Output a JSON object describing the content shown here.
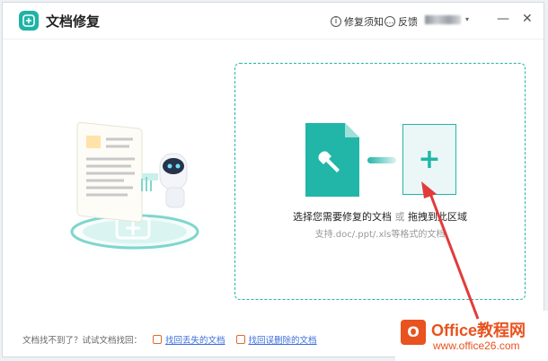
{
  "header": {
    "app_title": "文档修复",
    "help_label": "修复须知",
    "feedback_label": "反馈",
    "minimize_glyph": "—",
    "close_glyph": "✕"
  },
  "dropzone": {
    "instruction_main": "选择您需要修复的文档",
    "instruction_or": "或",
    "instruction_drag": "拖拽到此区域",
    "supported_formats": "支持.doc/.ppt/.xls等格式的文档",
    "plus_glyph": "+"
  },
  "footer": {
    "prompt": "文档找不到了？试试文档找回：",
    "link_lost": "找回丢失的文档",
    "link_deleted": "找回误删除的文档"
  },
  "watermark": {
    "name": "Office教程网",
    "url": "www.office26.com"
  },
  "colors": {
    "accent": "#21b6a8",
    "link": "#3d6edc",
    "brand": "#e8531f",
    "arrow": "#e23b3b"
  }
}
